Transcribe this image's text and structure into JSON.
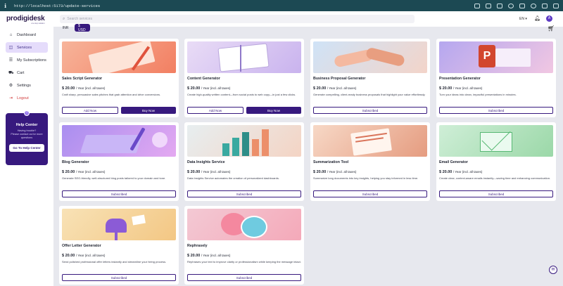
{
  "browser": {
    "url": "http://localhost:5173/update-services"
  },
  "app": {
    "logo": "prodigidesk",
    "logo_tagline": "one stop solution"
  },
  "nav": [
    {
      "label": "Dashboard",
      "icon": "⌂",
      "name": "dashboard"
    },
    {
      "label": "Services",
      "icon": "◫",
      "name": "services"
    },
    {
      "label": "My Subscriptions",
      "icon": "☰",
      "name": "subscriptions"
    },
    {
      "label": "Cart",
      "icon": "⛟",
      "name": "cart"
    },
    {
      "label": "Settings",
      "icon": "⚙",
      "name": "settings"
    },
    {
      "label": "Logout",
      "icon": "⇥",
      "name": "logout"
    }
  ],
  "help": {
    "title": "Help Center",
    "text1": "Having trouble?",
    "text2": "Please contact us for more questions",
    "button": "Go To Help Center"
  },
  "header": {
    "search_placeholder": "Search services",
    "lang": "EN",
    "avatar": "A"
  },
  "currency": {
    "inr": "INR",
    "usd": "$ USD"
  },
  "common": {
    "price": "$ 20.00",
    "per": "/ Year (incl. all taxes)",
    "add": "Add Now",
    "buy": "Buy Now",
    "subscribed": "Subscribed"
  },
  "cards": [
    {
      "title": "Sales Script Generator",
      "desc": "Craft sharp, persuasive sales pitches that grab attention and drive conversions.",
      "state": "buy"
    },
    {
      "title": "Content Generator",
      "desc": "Create high-quality written content—from social posts to web copy—in just a few clicks.",
      "state": "buy"
    },
    {
      "title": "Business Proposal Generator",
      "desc": "Generate compelling, client-ready business proposals that highlight your value effortlessly.",
      "state": "subscribed"
    },
    {
      "title": "Presentation Generator",
      "desc": "Turn your ideas into clean, impactful presentations in minutes.",
      "state": "subscribed"
    },
    {
      "title": "Blog Generator",
      "desc": "Generate SEO-friendly, well-structured blog posts tailored to your domain and tone.",
      "state": "subscribed"
    },
    {
      "title": "Data Insights Service",
      "desc": "Data Insights Service automates the creation of personalized dashboards.",
      "state": "subscribed"
    },
    {
      "title": "Summarization Tool",
      "desc": "Summarize long documents into key insights, helping you stay informed in less time.",
      "state": "subscribed"
    },
    {
      "title": "Email Generator",
      "desc": "Create clear, context-aware emails instantly—saving time and enhancing communication.",
      "state": "subscribed"
    },
    {
      "title": "Offer Letter Generator",
      "desc": "Send polished professional offer letters instantly and streamline your hiring process.",
      "state": "subscribed"
    },
    {
      "title": "Rephrasely",
      "desc": "Rephrases your text to improve clarity or professionalism while keeping the message intact.",
      "state": "subscribed"
    }
  ]
}
